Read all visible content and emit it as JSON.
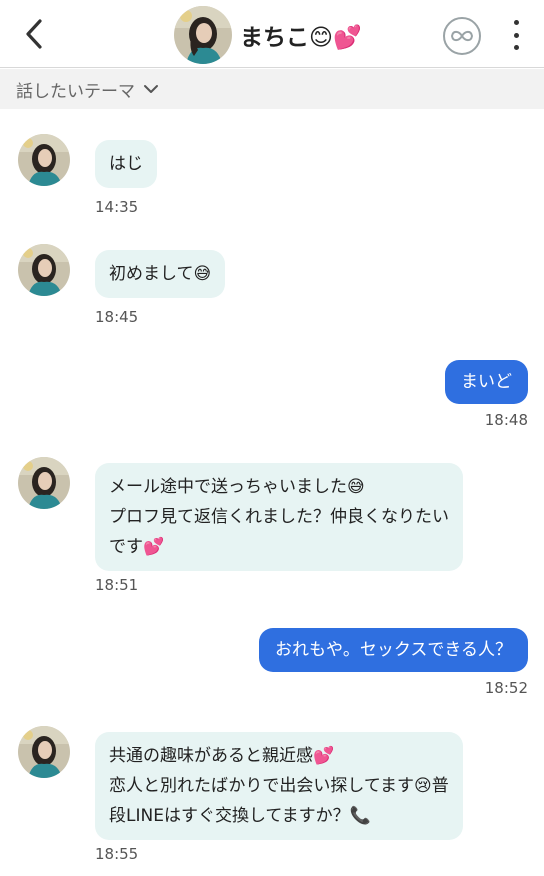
{
  "header": {
    "contact_name": "まちこ😊💕",
    "avatar_desc": "profile photo"
  },
  "topic_bar": {
    "label": "話したいテーマ"
  },
  "messages": [
    {
      "direction": "in",
      "lines": [
        "はじ"
      ],
      "time": "14:35"
    },
    {
      "direction": "in",
      "lines": [
        "初めまして😅"
      ],
      "time": "18:45"
    },
    {
      "direction": "out",
      "lines": [
        "まいど"
      ],
      "time": "18:48"
    },
    {
      "direction": "in",
      "lines": [
        "メール途中で送っちゃいました😅",
        "プロフ見て返信くれました？仲良くなりたい",
        "です💕"
      ],
      "time": "18:51"
    },
    {
      "direction": "out",
      "lines": [
        "おれもや。セックスできる人？"
      ],
      "time": "18:52"
    },
    {
      "direction": "in",
      "lines": [
        "共通の趣味があると親近感💕",
        "恋人と別れたばかりで出会い探してます😢普",
        "段LINEはすぐ交換してますか？📞"
      ],
      "time": "18:55"
    }
  ],
  "colors": {
    "incoming_bubble": "#e7f4f3",
    "outgoing_bubble": "#2f6fe0",
    "topic_bar_bg": "#f2f2f2"
  },
  "icons": {
    "back": "chevron-left-icon",
    "infinity": "infinity-icon",
    "more": "more-vertical-icon",
    "topic": "chevron-down-icon"
  }
}
